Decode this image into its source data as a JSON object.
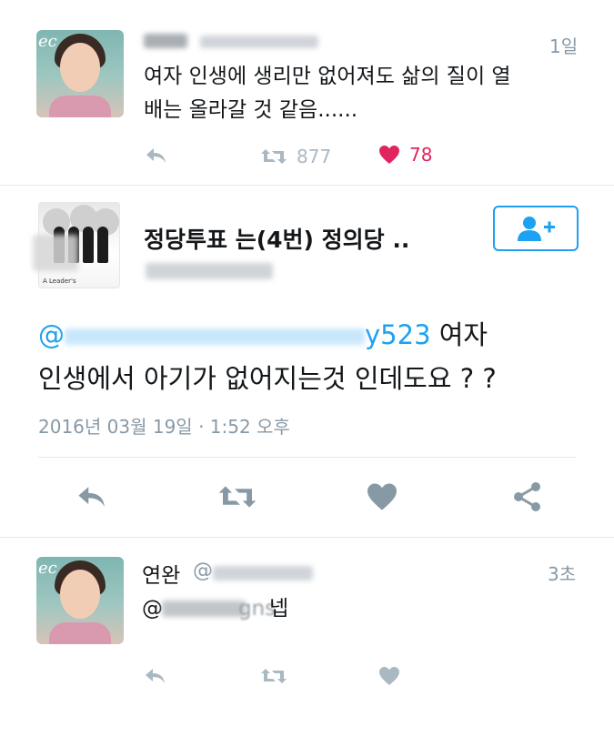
{
  "tweet1": {
    "time": "1일",
    "text_line1": "여자 인생에 생리만 없어져도 삶의 질이 열",
    "text_line2": "배는 올라갈 것 같음......",
    "retweets": "877",
    "likes": "78",
    "avatar_text": "ec"
  },
  "tweet2": {
    "display_name": "정당투표 는(4번)  정의당 ..",
    "photo_caption": "A Leader's",
    "mention_tail": "y523",
    "text_after_mention": " 여자",
    "text_line2": "인생에서 아기가 없어지는것 인데도요 ? ?",
    "timestamp": "2016년 03월 19일 · 1:52 오후"
  },
  "tweet3": {
    "display_name": "연완",
    "handle_prefix": "@",
    "time": "3초",
    "reply_prefix": "@",
    "reply_partial": "gns",
    "reply_text": " 넵",
    "avatar_text": "ec"
  },
  "colors": {
    "accent": "#1da1f2",
    "like": "#e0245e",
    "muted": "#8899a6",
    "icon": "#aab8c2",
    "divider": "#e1e8ed"
  }
}
